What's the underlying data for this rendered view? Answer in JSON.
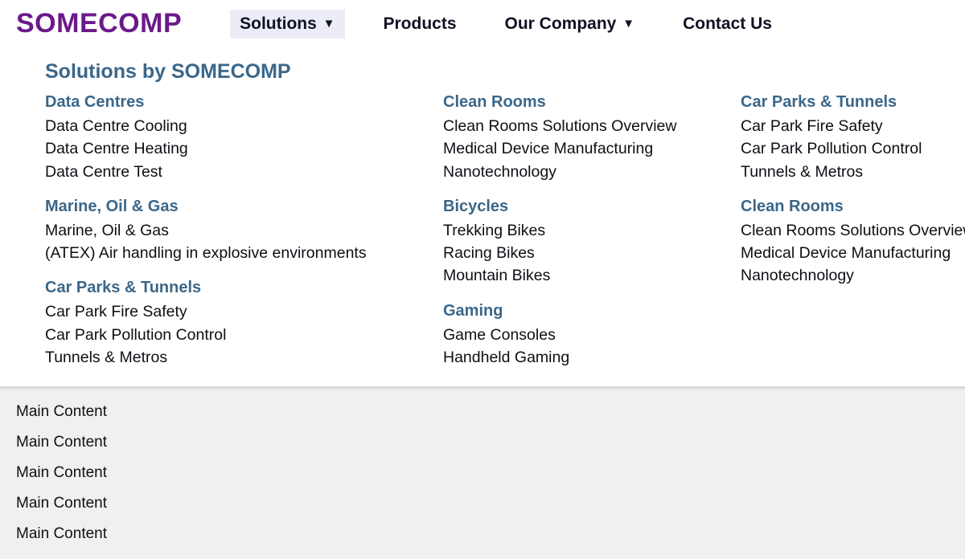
{
  "brand": "SOMECOMP",
  "nav": [
    {
      "label": "Solutions",
      "hasCaret": true,
      "active": true
    },
    {
      "label": "Products",
      "hasCaret": false,
      "active": false
    },
    {
      "label": "Our Company",
      "hasCaret": true,
      "active": false
    },
    {
      "label": "Contact Us",
      "hasCaret": false,
      "active": false
    }
  ],
  "mega": {
    "title": "Solutions by SOMECOMP",
    "columns": [
      [
        {
          "title": "Data Centres",
          "links": [
            "Data Centre Cooling",
            "Data Centre Heating",
            "Data Centre Test"
          ]
        },
        {
          "title": "Marine, Oil & Gas",
          "links": [
            "Marine, Oil & Gas",
            "(ATEX) Air handling in explosive environments"
          ]
        },
        {
          "title": "Car Parks & Tunnels",
          "links": [
            "Car Park Fire Safety",
            "Car Park Pollution Control",
            "Tunnels & Metros"
          ]
        }
      ],
      [
        {
          "title": "Clean Rooms",
          "links": [
            "Clean Rooms Solutions Overview",
            "Medical Device Manufacturing",
            "Nanotechnology"
          ]
        },
        {
          "title": "Bicycles",
          "links": [
            "Trekking Bikes",
            "Racing Bikes",
            "Mountain Bikes"
          ]
        },
        {
          "title": "Gaming",
          "links": [
            "Game Consoles",
            "Handheld Gaming"
          ]
        }
      ],
      [
        {
          "title": "Car Parks & Tunnels",
          "links": [
            "Car Park Fire Safety",
            "Car Park Pollution Control",
            "Tunnels & Metros"
          ]
        },
        {
          "title": "Clean Rooms",
          "links": [
            "Clean Rooms Solutions Overview",
            "Medical Device Manufacturing",
            "Nanotechnology"
          ]
        }
      ]
    ]
  },
  "main": {
    "rows": [
      "Main Content",
      "Main Content",
      "Main Content",
      "Main Content",
      "Main Content"
    ]
  },
  "glyphs": {
    "caret": "▼"
  }
}
